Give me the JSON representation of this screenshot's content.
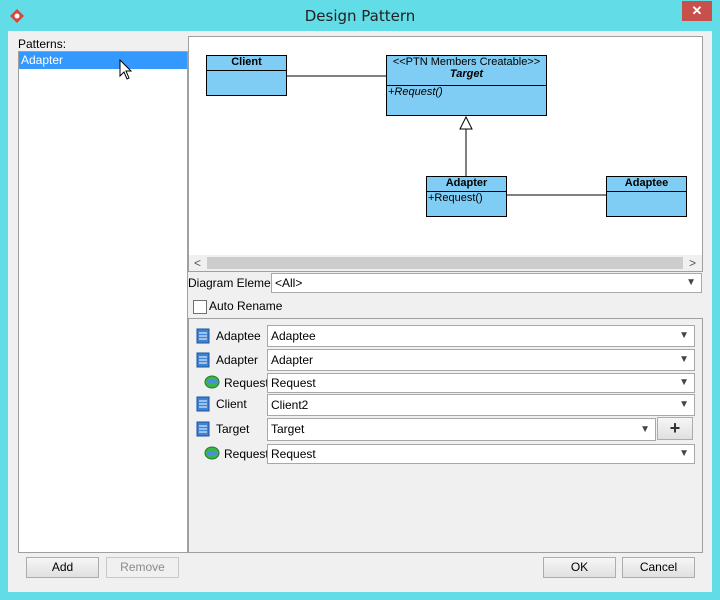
{
  "window": {
    "title": "Design Pattern",
    "close_glyph": "✕"
  },
  "patterns": {
    "label": "Patterns:",
    "items": [
      "Adapter"
    ]
  },
  "diagram": {
    "client": {
      "name": "Client"
    },
    "target": {
      "stereotype": "<<PTN Members Creatable>>",
      "name": "Target",
      "operation": "+Request()"
    },
    "adapter": {
      "name": "Adapter",
      "operation": "+Request()"
    },
    "adaptee": {
      "name": "Adaptee"
    },
    "scroll_left": "<",
    "scroll_right": ">"
  },
  "diagram_element": {
    "label": "Diagram Element",
    "value": "<All>"
  },
  "auto_rename": {
    "label": "Auto Rename",
    "checked": false
  },
  "mappings": [
    {
      "label": "Adaptee",
      "value": "Adaptee",
      "icon": "class-icon"
    },
    {
      "label": "Adapter",
      "value": "Adapter",
      "icon": "class-icon"
    },
    {
      "label": "Request",
      "value": "Request",
      "icon": "operation-icon"
    },
    {
      "label": "Client",
      "value": "Client2",
      "icon": "class-icon"
    },
    {
      "label": "Target",
      "value": "Target",
      "icon": "class-icon"
    },
    {
      "label": "Request",
      "value": "Request",
      "icon": "operation-icon"
    }
  ],
  "buttons": {
    "add": "Add",
    "remove": "Remove",
    "ok": "OK",
    "cancel": "Cancel",
    "plus": "+"
  },
  "colors": {
    "titlebar": "#62dce6",
    "uml_fill": "#7fcdf4",
    "selection": "#3399ff",
    "close": "#c7504b"
  }
}
